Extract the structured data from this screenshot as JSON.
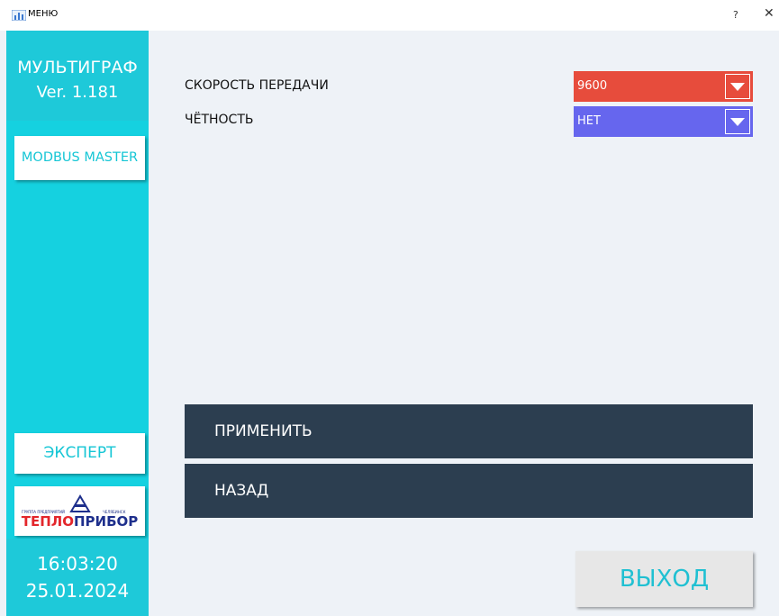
{
  "window": {
    "title": "МЕНЮ",
    "help_label": "?",
    "close_label": "✕"
  },
  "sidebar": {
    "brand_name": "МУЛЬТИГРАФ",
    "version": "Ver. 1.181",
    "modbus_label": "MODBUS MASTER",
    "expert_label": "ЭКСПЕРТ",
    "logo": {
      "small_left": "ГРУППА ПРЕДПРИЯТИЙ",
      "small_right": "ЧЕЛЯБИНСК",
      "part_red": "ТЕПЛО",
      "part_blue": "ПРИБОР"
    },
    "time": "16:03:20",
    "date": "25.01.2024"
  },
  "settings": {
    "speed_label": "СКОРОСТЬ ПЕРЕДАЧИ",
    "speed_value": "9600",
    "parity_label": "ЧЁТНОСТЬ",
    "parity_value": "НЕТ"
  },
  "actions": {
    "apply_label": "ПРИМЕНИТЬ",
    "back_label": "НАЗАД",
    "exit_label": "ВЫХОД"
  },
  "colors": {
    "sidebar": "#15d1e0",
    "speed_select": "#e74c3c",
    "parity_select": "#6666ee",
    "action_button": "#2c3e50"
  }
}
